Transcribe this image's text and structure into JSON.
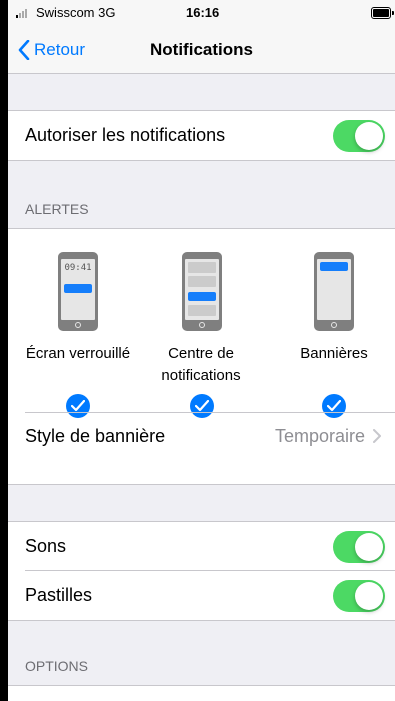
{
  "status_bar": {
    "carrier": "Swisscom 3G",
    "time": "16:16"
  },
  "nav": {
    "back_label": "Retour",
    "title": "Notifications"
  },
  "allow": {
    "label": "Autoriser les notifications",
    "enabled": true
  },
  "alerts": {
    "header": "ALERTES",
    "styles": [
      {
        "label": "Écran verrouillé",
        "phone_time": "09:41",
        "checked": true
      },
      {
        "label": "Centre de notifications",
        "checked": true
      },
      {
        "label": "Bannières",
        "checked": true
      }
    ],
    "banner_style": {
      "label": "Style de bannière",
      "value": "Temporaire"
    }
  },
  "sounds": {
    "label": "Sons",
    "enabled": true
  },
  "badges": {
    "label": "Pastilles",
    "enabled": true
  },
  "options": {
    "header": "OPTIONS"
  },
  "colors": {
    "accent": "#007aff",
    "toggle_on": "#4cd964",
    "background": "#efeff4"
  }
}
